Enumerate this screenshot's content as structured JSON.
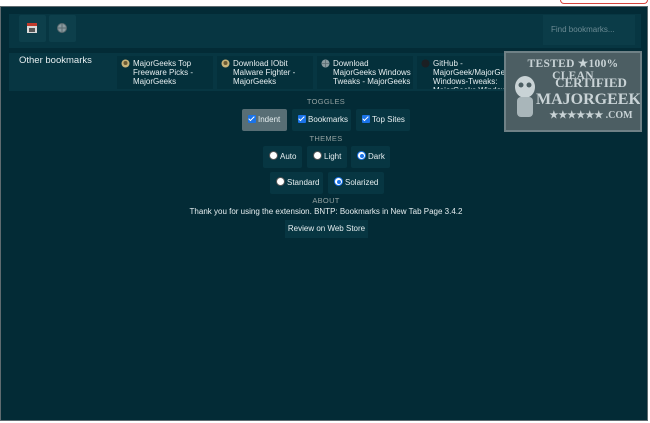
{
  "search": {
    "placeholder": "Find bookmarks..."
  },
  "bookmarks_bar": {
    "folder_label": "Other bookmarks",
    "items": [
      {
        "label": "MajorGeeks Top Freeware Picks - MajorGeeks",
        "icon": "majorgeeks-favicon"
      },
      {
        "label": "Download IObit Malware Fighter - MajorGeeks",
        "icon": "majorgeeks-favicon"
      },
      {
        "label": "Download MajorGeeks Windows Tweaks - MajorGeeks",
        "icon": "globe-icon"
      },
      {
        "label": "GitHub - MajorGeek/MajorGeeks-Windows-Tweaks: MajorGeeks Windows",
        "icon": "github-icon"
      }
    ]
  },
  "toggles": {
    "heading": "TOGGLES",
    "items": [
      {
        "label": "Indent",
        "checked": true
      },
      {
        "label": "Bookmarks",
        "checked": true
      },
      {
        "label": "Top Sites",
        "checked": true
      }
    ]
  },
  "themes": {
    "heading": "THEMES",
    "modes": [
      {
        "label": "Auto",
        "selected": false
      },
      {
        "label": "Light",
        "selected": false
      },
      {
        "label": "Dark",
        "selected": true
      }
    ],
    "palettes": [
      {
        "label": "Standard",
        "selected": false
      },
      {
        "label": "Solarized",
        "selected": true
      }
    ]
  },
  "about": {
    "heading": "ABOUT",
    "text": "Thank you for using the extension. BNTP: Bookmarks in New Tab Page 3.4.2",
    "review_label": "Review on Web Store"
  },
  "badge": {
    "line1": "TESTED ★100% CLEAN",
    "line2": "CERTIFIED",
    "line3": "MAJORGEEKS",
    "line4": "★★★★★★ .COM"
  },
  "colors": {
    "background": "#032b36",
    "panel": "#073642",
    "active_option": "#586e75",
    "text": "#e6eef0",
    "heading": "#93a1a1",
    "accent": "#1a73e8"
  }
}
